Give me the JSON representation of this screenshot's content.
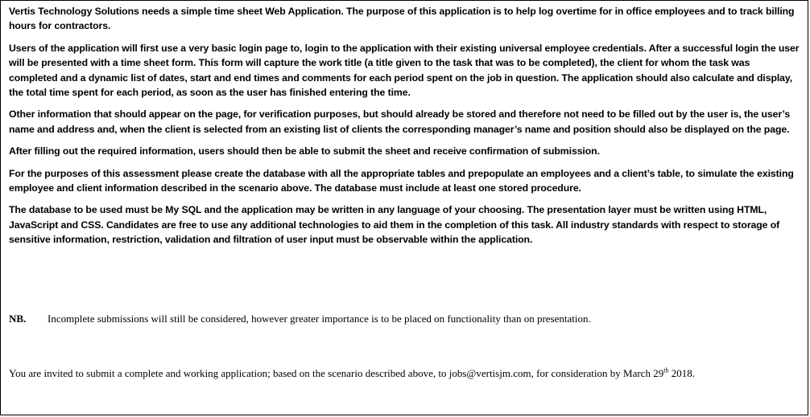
{
  "paragraphs": [
    "Vertis Technology Solutions needs a simple time sheet Web Application. The purpose of this application is to help log overtime for in office employees and to track billing hours for contractors.",
    "Users of the application will first use a very basic login page to, login to the application with their existing universal employee credentials. After a successful login the user will be presented with a time sheet form. This form will capture the work title (a title given to the task that was to be completed), the client for whom the task was completed and a dynamic list of dates, start and end times and comments for each period spent on the job in question. The application should also calculate and display, the total time spent for each period, as soon as the user has finished entering the time.",
    "Other information that should appear on the page, for verification purposes, but should already be stored and therefore not need to be filled out by the user is, the user’s name and address and, when the client is selected from an existing list of clients the corresponding manager’s name and position should also be displayed on the page.",
    "After filling out the required information, users should then be able to submit the sheet and receive confirmation of submission.",
    "For the purposes of this assessment please create the database with all the appropriate tables and prepopulate an employees and a client’s table, to simulate the existing employee and client information described in the scenario above. The database must include at least one stored procedure.",
    "The database to be used must be My SQL and the application may be written in any language of your choosing. The presentation layer must be written using HTML, JavaScript and CSS. Candidates are free to use any additional technologies to aid them in the completion of this task. All industry standards with respect to storage of sensitive information, restriction, validation and filtration of user input must be observable within the application."
  ],
  "note": {
    "label": "NB.",
    "text": "Incomplete submissions will still be considered, however greater importance is to be placed on functionality than on presentation."
  },
  "invitation": {
    "text_before": "You are invited to submit a complete and working application; based on the scenario described above, to jobs@vertisjm.com, for consideration by March 29",
    "ordinal_suffix": "th",
    "text_after": " 2018."
  }
}
